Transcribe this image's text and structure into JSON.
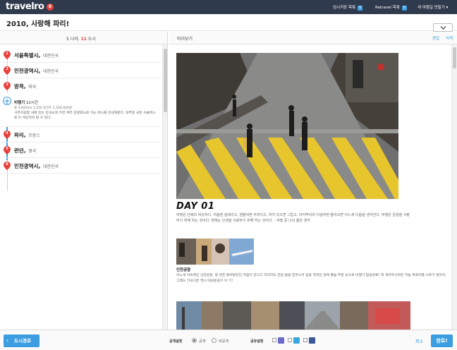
{
  "app": {
    "logo": "travelro",
    "logo_badge": "8"
  },
  "topnav": [
    {
      "label": "임시저장 목록",
      "count": "0"
    },
    {
      "label": "Retravel 목록",
      "count": "0"
    },
    {
      "label": "새 여행길 만들기 ▾"
    }
  ],
  "trip": {
    "title": "2010, 사랑해 파리!"
  },
  "left": {
    "header_prefix": "5 나라, ",
    "header_count": "11",
    "header_suffix": " 도시",
    "cities": [
      {
        "num": "1",
        "name": "서울특별시",
        "country": "대한민국"
      },
      {
        "num": "2",
        "name": "인천광역시",
        "country": "대한민국"
      },
      {
        "num": "3",
        "name": "방콕",
        "country": "태국"
      },
      {
        "num": "4",
        "name": "파리",
        "country": "프랑스"
      },
      {
        "num": "5",
        "name": "런던",
        "country": "영국"
      },
      {
        "num": "6",
        "name": "인천광역시",
        "country": "대한민국"
      }
    ],
    "transport": {
      "icon": "airplane-icon",
      "name": "비행기",
      "duration": "12시간",
      "details": "총 3,945km      1,500 포인트   1,500,000원",
      "description": "사무지공항 내에 있는 안내소에 가면 여러 관광명소로 가는 버스를 안내해준다. 대부분 국은 서울버스로 5~9인까지 탈 수 있다."
    }
  },
  "preview": {
    "label": "미리보기",
    "edit": "편집",
    "delete": "삭제",
    "day_title": "DAY 01",
    "day_desc": "여행은 언제라 비슷하다. 처음엔 설레이고, 점볼되면 두려지고, 하지 있으면 그립고, 마지막이라 다설하면 돌아오면 어느새 다음을 생각한다. 여행은 일생을 사랑하기 위해 하는 것이다. 면에는 인생을 사랑하기 위해 하는 것이다. - 여행 중 나의 짧은 생각",
    "place_title": "인천공항",
    "place_desc": "어느새 익숙해진 인천공항. 몇 번은 들떠왔던던 처럼이 있다고 하더라도 전날 밤을 집부스러 짐을 하려던 정에 졸음 부운 눈으로 비행기 탑승완료! 게 세라마시픽은 허늘 위로라를 나르기 앉아라. 그래도 기내식은 역시 대원문공이 이 기!"
  },
  "bottom": {
    "back_label": "도시경로",
    "public_label": "공개설정",
    "public_option": "공개",
    "private_option": "비공개",
    "share_label": "공유설정",
    "cancel": "취소",
    "done": "완료!"
  },
  "colors": {
    "accent": "#3c9ee0",
    "pin": "#e8403a",
    "topbar": "#2f3a4c"
  }
}
